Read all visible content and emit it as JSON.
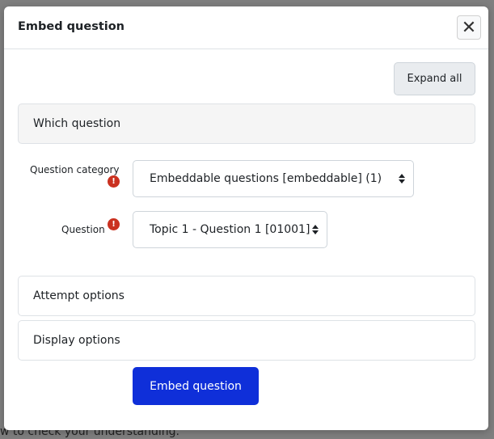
{
  "modal": {
    "title": "Embed question",
    "close_glyph": "✕",
    "expand_all_label": "Expand all",
    "sections": {
      "which": "Which question",
      "attempt": "Attempt options",
      "display": "Display options"
    },
    "fields": {
      "category": {
        "label": "Question category",
        "value": "Embeddable questions [embeddable] (1)",
        "required_icon": "!"
      },
      "question": {
        "label": "Question",
        "value": "Topic 1 - Question 1 [01001]",
        "required_icon": "!"
      }
    },
    "submit_label": "Embed question"
  },
  "backdrop": {
    "bottom_text": "w to check your understanding."
  },
  "colors": {
    "primary": "#0f2fd9",
    "required": "#ca3120",
    "overlay": "#7f7f7f"
  }
}
